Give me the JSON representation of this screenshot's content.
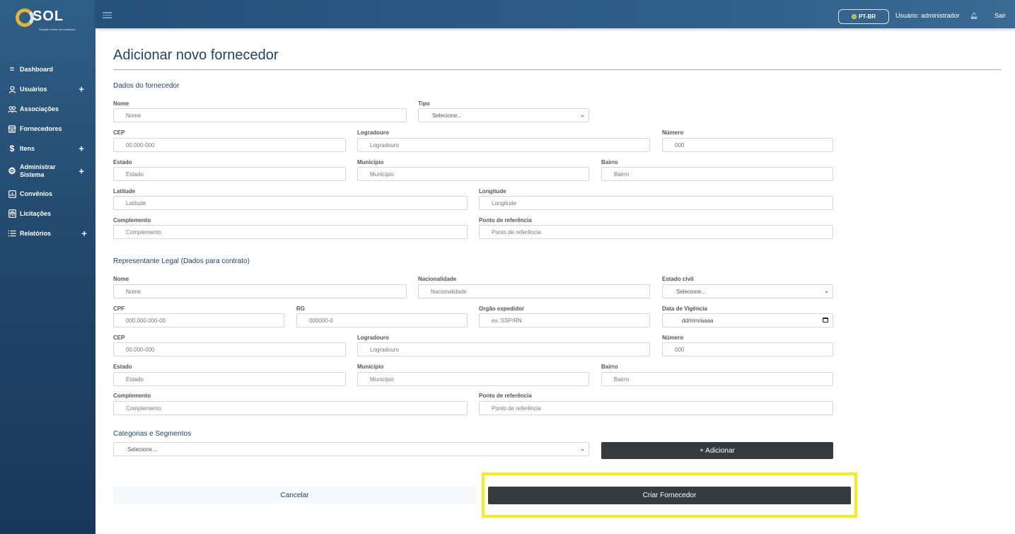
{
  "brand": {
    "name": "SOL",
    "tagline": "Solução Online de Licitações"
  },
  "sidebar": {
    "items": [
      {
        "label": "Dashboard",
        "icon": "menu-lines-icon",
        "expandable": false
      },
      {
        "label": "Usuários",
        "icon": "user-icon",
        "expandable": true
      },
      {
        "label": "Associações",
        "icon": "users-group-icon",
        "expandable": false
      },
      {
        "label": "Fornecedores",
        "icon": "store-icon",
        "expandable": false
      },
      {
        "label": "Itens",
        "icon": "dollar-icon",
        "expandable": true
      },
      {
        "label": "Administrar Sistema",
        "icon": "gear-icon",
        "expandable": true
      },
      {
        "label": "Convênios",
        "icon": "chart-icon",
        "expandable": false
      },
      {
        "label": "Licitações",
        "icon": "building-icon",
        "expandable": false
      },
      {
        "label": "Relatórios",
        "icon": "list-icon",
        "expandable": true
      }
    ],
    "plus_glyph": "+"
  },
  "topbar": {
    "language": "PT-BR",
    "user": "Usuário: administrador",
    "logout": "Sair"
  },
  "page": {
    "title": "Adicionar novo fornecedor",
    "section_supplier": "Dados do fornecedor",
    "section_legal": "Representante Legal (Dados para contrato)",
    "section_categories": "Categorias e Segmentos"
  },
  "supplier": {
    "nome": {
      "label": "Nome",
      "placeholder": "Nome"
    },
    "tipo": {
      "label": "Tipo",
      "value": "Selecione..."
    },
    "cep": {
      "label": "CEP",
      "placeholder": "00.000-000"
    },
    "logradouro": {
      "label": "Logradouro",
      "placeholder": "Logradouro"
    },
    "numero": {
      "label": "Número",
      "placeholder": "000"
    },
    "estado": {
      "label": "Estado",
      "placeholder": "Estado"
    },
    "municipio": {
      "label": "Município",
      "placeholder": "Municipio"
    },
    "bairro": {
      "label": "Bairro",
      "placeholder": "Bairro"
    },
    "latitude": {
      "label": "Latitude",
      "placeholder": "Latitude"
    },
    "longitude": {
      "label": "Longitude",
      "placeholder": "Longitude"
    },
    "complemento": {
      "label": "Complemento",
      "placeholder": "Complemento"
    },
    "referencia": {
      "label": "Ponto de referência",
      "placeholder": "Ponto de referência"
    }
  },
  "legal": {
    "nome": {
      "label": "Nome",
      "placeholder": "Nome"
    },
    "nacionalidade": {
      "label": "Nacionalidade",
      "placeholder": "Nacionalidade"
    },
    "estado_civil": {
      "label": "Estado civil",
      "value": "Selecione..."
    },
    "cpf": {
      "label": "CPF",
      "placeholder": "000.000.000-00"
    },
    "rg": {
      "label": "RG",
      "placeholder": "000000-0"
    },
    "orgao": {
      "label": "Orgão expedidor",
      "placeholder": "ex.:SSP/RN"
    },
    "vigencia": {
      "label": "Data de Vigência",
      "placeholder": "dd/mm/aaaa"
    },
    "cep": {
      "label": "CEP",
      "placeholder": "00.000-000"
    },
    "logradouro": {
      "label": "Logradouro",
      "placeholder": "Logradouro"
    },
    "numero": {
      "label": "Número",
      "placeholder": "000"
    },
    "estado": {
      "label": "Estado",
      "placeholder": "Estado"
    },
    "municipio": {
      "label": "Município",
      "placeholder": "Municipio"
    },
    "bairro": {
      "label": "Bairro",
      "placeholder": "Bairro"
    },
    "complemento": {
      "label": "Complemento",
      "placeholder": "Complemento"
    },
    "referencia": {
      "label": "Ponto de referência",
      "placeholder": "Ponto de referência"
    }
  },
  "categories": {
    "value": "Selecione...",
    "add_button": "+ Adicionar"
  },
  "actions": {
    "cancel": "Cancelar",
    "create": "Criar Fornecedor"
  },
  "colors": {
    "sidebar": "#1f4468",
    "accent": "#1f4468",
    "button_dark": "#333a40",
    "highlight": "#f4ee1c"
  }
}
